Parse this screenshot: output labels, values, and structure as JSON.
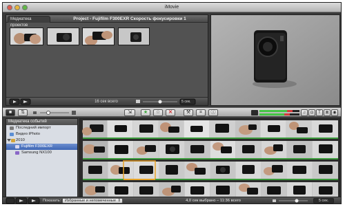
{
  "app": {
    "title": "iMovie"
  },
  "project": {
    "library_tab": "Медиатека проектов",
    "title": "Project - Fujifilm F300EXR Скорость фокусировки 1",
    "clip_count": "16 сек всего",
    "zoom_value": "5 сек."
  },
  "event_library": {
    "header": "Медиатека событий",
    "items": [
      {
        "label": "Последний импорт"
      },
      {
        "label": "Видео iPhoto"
      },
      {
        "label": "2010"
      },
      {
        "label": "Fujifilm F300EXR"
      },
      {
        "label": "Samsung NX100"
      }
    ]
  },
  "bottom": {
    "show_label": "Показать:",
    "filter_value": "Избранные и непомеченные",
    "status": "4,0 сек выбрано – 11:36 всего",
    "zoom_value": "5 сек."
  },
  "colors": {
    "favorite_star": "#3aa63a",
    "reject_x": "#cc2b2b",
    "selected_event": "#3e66b5",
    "audio_meter_green": "#45c545",
    "audio_meter_red": "#d33a3a"
  }
}
